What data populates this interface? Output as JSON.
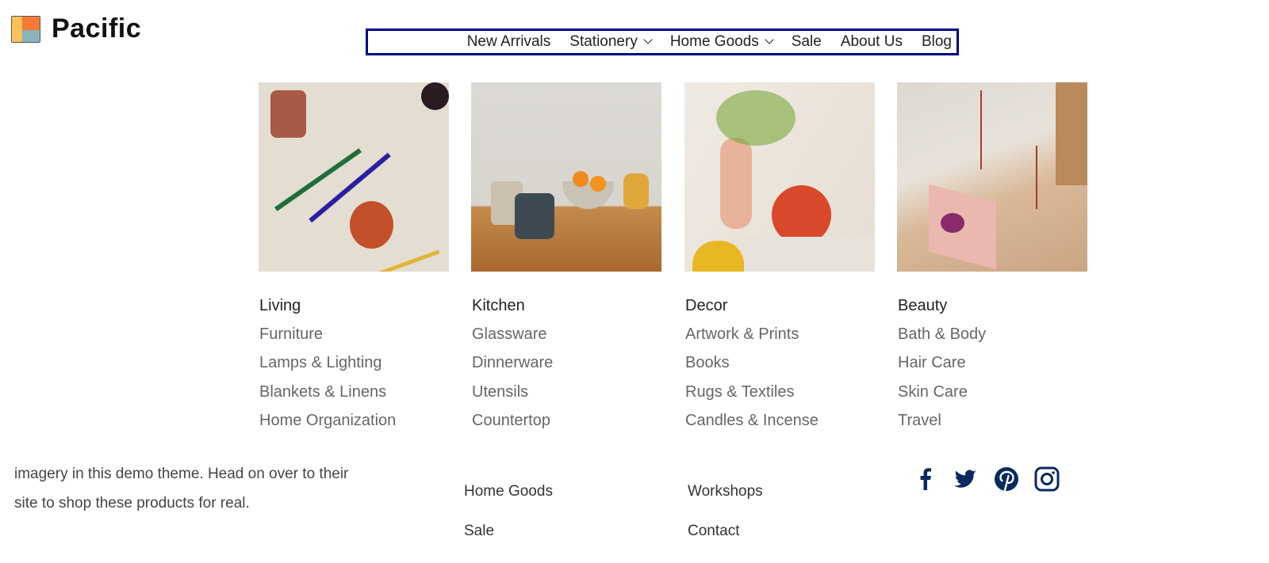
{
  "brand": {
    "name": "Pacific"
  },
  "nav": {
    "items": [
      {
        "label": "New Arrivals",
        "dropdown": false
      },
      {
        "label": "Stationery",
        "dropdown": true
      },
      {
        "label": "Home Goods",
        "dropdown": true
      },
      {
        "label": "Sale",
        "dropdown": false
      },
      {
        "label": "About Us",
        "dropdown": false
      },
      {
        "label": "Blog",
        "dropdown": false
      }
    ],
    "highlight_color": "#00008b"
  },
  "mega_menu": {
    "columns": [
      {
        "heading": "Living",
        "links": [
          "Furniture",
          "Lamps & Lighting",
          "Blankets & Linens",
          "Home Organization"
        ]
      },
      {
        "heading": "Kitchen",
        "links": [
          "Glassware",
          "Dinnerware",
          "Utensils",
          "Countertop"
        ]
      },
      {
        "heading": "Decor",
        "links": [
          "Artwork & Prints",
          "Books",
          "Rugs & Textiles",
          "Candles & Incense"
        ]
      },
      {
        "heading": "Beauty",
        "links": [
          "Bath & Body",
          "Hair Care",
          "Skin Care",
          "Travel"
        ]
      }
    ]
  },
  "footer": {
    "text_lines": [
      "imagery in this demo theme. Head on over to their",
      "site to shop these products for real."
    ],
    "links_col1": [
      "Home Goods",
      "Sale"
    ],
    "links_col2": [
      "Workshops",
      "Contact"
    ],
    "social": [
      "facebook-icon",
      "twitter-icon",
      "pinterest-icon",
      "instagram-icon"
    ],
    "social_color": "#0a2a5e"
  }
}
